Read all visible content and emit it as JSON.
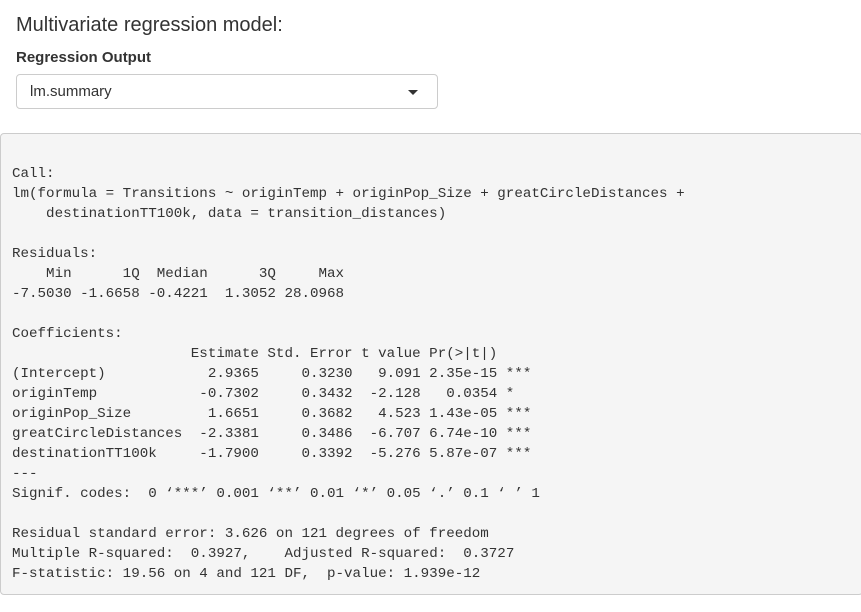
{
  "title": "Multivariate regression model:",
  "control": {
    "label": "Regression Output",
    "selected": "lm.summary"
  },
  "output": {
    "text": "Call:\nlm(formula = Transitions ~ originTemp + originPop_Size + greatCircleDistances + \n    destinationTT100k, data = transition_distances)\n\nResiduals:\n    Min      1Q  Median      3Q     Max \n-7.5030 -1.6658 -0.4221  1.3052 28.0968 \n\nCoefficients:\n                     Estimate Std. Error t value Pr(>|t|)    \n(Intercept)            2.9365     0.3230   9.091 2.35e-15 ***\noriginTemp            -0.7302     0.3432  -2.128   0.0354 *  \noriginPop_Size         1.6651     0.3682   4.523 1.43e-05 ***\ngreatCircleDistances  -2.3381     0.3486  -6.707 6.74e-10 ***\ndestinationTT100k     -1.7900     0.3392  -5.276 5.87e-07 ***\n---\nSignif. codes:  0 ‘***’ 0.001 ‘**’ 0.01 ‘*’ 0.05 ‘.’ 0.1 ‘ ’ 1\n\nResidual standard error: 3.626 on 121 degrees of freedom\nMultiple R-squared:  0.3927,\tAdjusted R-squared:  0.3727 \nF-statistic: 19.56 on 4 and 121 DF,  p-value: 1.939e-12"
  }
}
